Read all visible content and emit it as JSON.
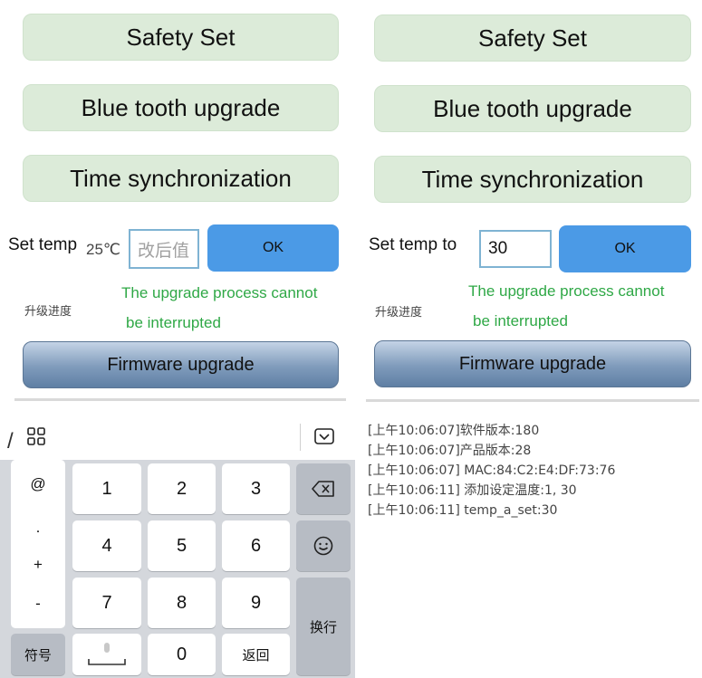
{
  "left": {
    "safety_set": "Safety Set",
    "bluetooth_upgrade": "Blue tooth upgrade",
    "time_sync": "Time synchronization",
    "set_temp_label": "Set temp",
    "temp_unit": "25℃",
    "temp_placeholder": "改后值",
    "ok": "OK",
    "progress_label": "升级进度",
    "warning_line1": "The upgrade process cannot",
    "warning_line2": "be interrupted",
    "firmware_upgrade": "Firmware upgrade"
  },
  "right": {
    "safety_set": "Safety Set",
    "bluetooth_upgrade": "Blue tooth upgrade",
    "time_sync": "Time synchronization",
    "set_temp_label": "Set temp to",
    "temp_value": "30",
    "ok": "OK",
    "progress_label": "升级进度",
    "warning_line1": "The upgrade process cannot",
    "warning_line2": "be interrupted",
    "firmware_upgrade": "Firmware upgrade",
    "log": [
      "[上午10:06:07]软件版本:180",
      "[上午10:06:07]产品版本:28",
      "[上午10:06:07] MAC:84:C2:E4:DF:73:76",
      "[上午10:06:11] 添加设定温度:1, 30",
      "[上午10:06:11] temp_a_set:30"
    ]
  },
  "keyboard": {
    "side_keys": [
      "@",
      ".",
      "+",
      "-"
    ],
    "digits": [
      "1",
      "2",
      "3",
      "4",
      "5",
      "6",
      "7",
      "8",
      "9",
      "0"
    ],
    "symbols_key": "符号",
    "back_key": "返回",
    "newline_key": "换行",
    "icons": {
      "grid": "grid-icon",
      "collapse": "collapse-keyboard-icon",
      "backspace": "backspace-icon",
      "emoji": "emoji-icon",
      "microphone": "microphone-icon"
    }
  }
}
